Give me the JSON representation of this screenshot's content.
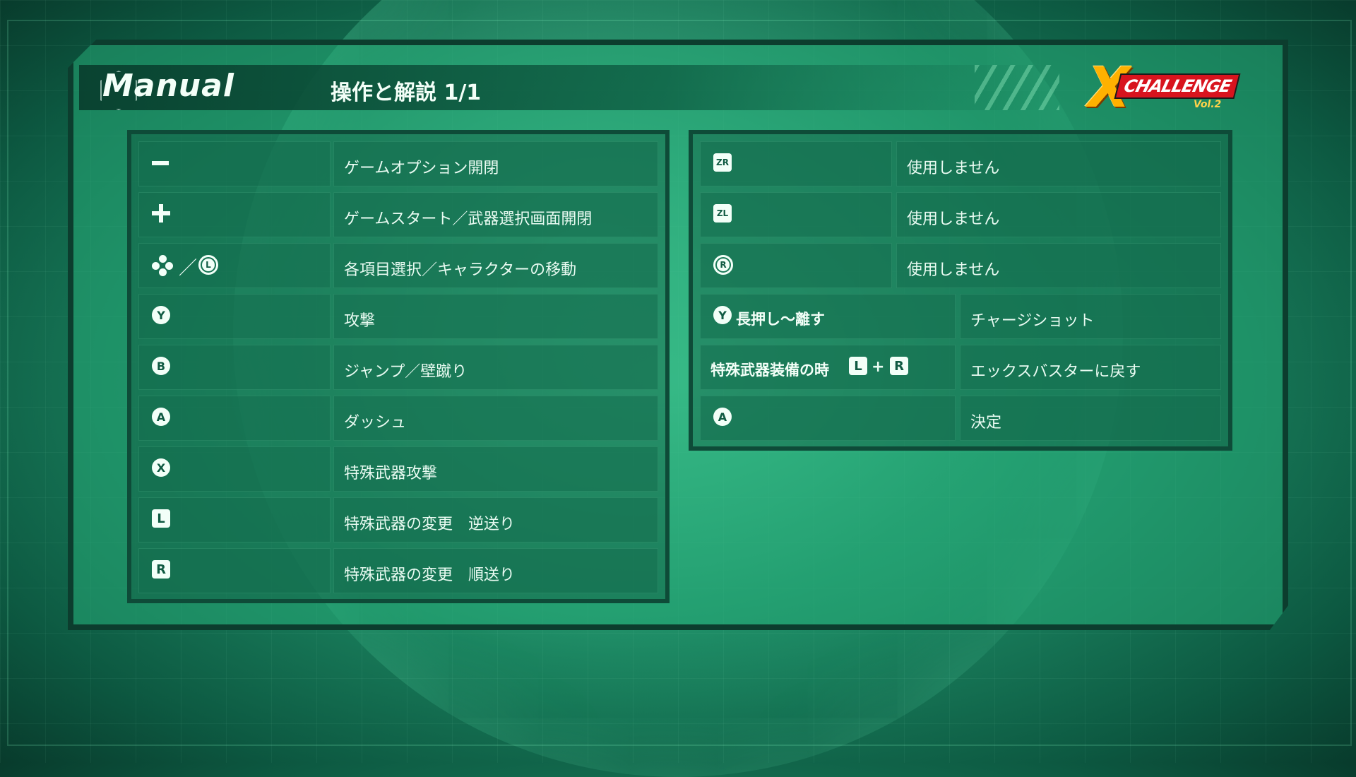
{
  "header": {
    "manual_label": "Manual",
    "page_title": "操作と解説 1/1",
    "logo": {
      "big": "X",
      "challenge": "CHALLENGE",
      "vol": "Vol.2"
    }
  },
  "left_rows": [
    {
      "button": "−",
      "icon": "minus-button-icon",
      "desc": "ゲームオプション開閉"
    },
    {
      "button": "+",
      "icon": "plus-button-icon",
      "desc": "ゲームスタート／武器選択画面開閉"
    },
    {
      "button": "L",
      "icon": "dpad-or-left-stick-icon",
      "desc": "各項目選択／キャラクターの移動"
    },
    {
      "button": "Y",
      "icon": "y-button-icon",
      "desc": "攻撃"
    },
    {
      "button": "B",
      "icon": "b-button-icon",
      "desc": "ジャンプ／壁蹴り"
    },
    {
      "button": "A",
      "icon": "a-button-icon",
      "desc": "ダッシュ"
    },
    {
      "button": "X",
      "icon": "x-button-icon",
      "desc": "特殊武器攻撃"
    },
    {
      "button": "L",
      "icon": "l-button-icon",
      "desc": "特殊武器の変更　逆送り"
    },
    {
      "button": "R",
      "icon": "r-button-icon",
      "desc": "特殊武器の変更　順送り"
    }
  ],
  "right_rows": [
    {
      "button": "ZR",
      "icon": "zr-button-icon",
      "desc": "使用しません"
    },
    {
      "button": "ZL",
      "icon": "zl-button-icon",
      "desc": "使用しません"
    },
    {
      "button": "R",
      "icon": "right-stick-press-icon",
      "desc": "使用しません"
    },
    {
      "button": "Y",
      "icon": "y-button-icon",
      "label": "長押し〜離す",
      "desc": "チャージショット"
    },
    {
      "label": "特殊武器装備の時",
      "button_l": "L",
      "plus": "+",
      "button_r": "R",
      "desc": "エックスバスターに戻す"
    },
    {
      "button": "A",
      "icon": "a-button-icon",
      "desc": "決定"
    }
  ]
}
